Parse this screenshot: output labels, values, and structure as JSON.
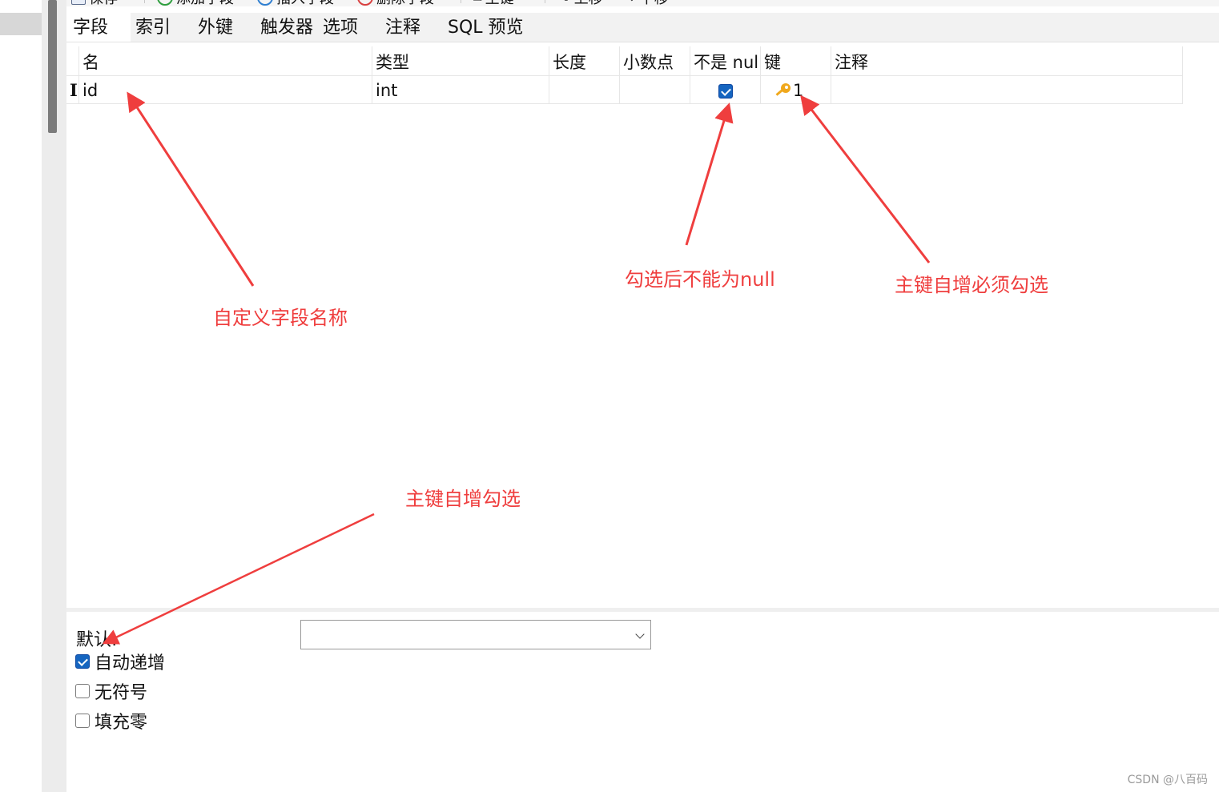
{
  "toolbar": {
    "items": [
      {
        "label": "保存",
        "icon": "save-icon"
      },
      {
        "label": "添加字段",
        "icon": "add-field-icon"
      },
      {
        "label": "插入字段",
        "icon": "insert-field-icon"
      },
      {
        "label": "删除字段",
        "icon": "delete-field-icon"
      },
      {
        "label": "主键",
        "icon": "key-icon"
      },
      {
        "label": "上移",
        "icon": "arrow-up-icon"
      },
      {
        "label": "下移",
        "icon": "arrow-down-icon"
      }
    ]
  },
  "tabs": [
    {
      "label": "字段",
      "active": true
    },
    {
      "label": "索引"
    },
    {
      "label": "外键"
    },
    {
      "label": "触发器"
    },
    {
      "label": "选项"
    },
    {
      "label": "注释"
    },
    {
      "label": "SQL 预览"
    }
  ],
  "grid": {
    "columns": [
      "名",
      "类型",
      "长度",
      "小数点",
      "不是 null",
      "键",
      "注释"
    ],
    "rows": [
      {
        "marker": "I",
        "name": "id",
        "type": "int",
        "length": "",
        "decimals": "",
        "not_null": true,
        "key": "1",
        "comment": ""
      }
    ]
  },
  "properties": {
    "default_label": "默认:",
    "default_value": "",
    "auto_increment_label": "自动递增",
    "auto_increment": true,
    "unsigned_label": "无符号",
    "unsigned": false,
    "zerofill_label": "填充零",
    "zerofill": false
  },
  "annotations": {
    "field_name": "自定义字段名称",
    "not_null": "勾选后不能为null",
    "primary_key": "主键自增必须勾选",
    "auto_increment": "主键自增勾选"
  },
  "colors": {
    "annotation": "#ef3e3e",
    "checkbox": "#1565c0",
    "key": "#f0a81c"
  },
  "watermark": "CSDN @八百码"
}
